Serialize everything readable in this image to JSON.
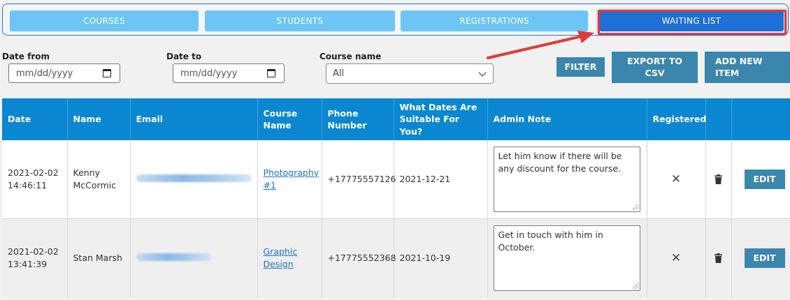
{
  "tabs": [
    {
      "label": "COURSES",
      "active": false
    },
    {
      "label": "STUDENTS",
      "active": false
    },
    {
      "label": "REGISTRATIONS",
      "active": false
    },
    {
      "label": "WAITING LIST",
      "active": true
    }
  ],
  "filters": {
    "date_from_label": "Date from",
    "date_from_placeholder": "mm/dd/yyyy",
    "date_to_label": "Date to",
    "date_to_placeholder": "mm/dd/yyyy",
    "course_label": "Course name",
    "course_value": "All"
  },
  "actions": {
    "filter": "FILTER",
    "export_line1": "EXPORT TO",
    "export_line2": "CSV",
    "add_line1": "ADD NEW",
    "add_line2": "ITEM"
  },
  "table": {
    "headers": {
      "date": "Date",
      "name": "Name",
      "email": "Email",
      "course_l1": "Course",
      "course_l2": "Name",
      "phone_l1": "Phone",
      "phone_l2": "Number",
      "dates_l1": "What Dates Are",
      "dates_l2": "Suitable For You?",
      "note": "Admin Note",
      "registered": "Registered"
    },
    "rows": [
      {
        "date": "2021-02-02",
        "time": "14:46:11",
        "name_l1": "Kenny",
        "name_l2": "McCormic",
        "course_l1": "Photography",
        "course_l2": "#1",
        "phone": "+17775557126",
        "suitable": "2021-12-21",
        "note": "Let him know if there will be any discount for the course.",
        "registered": "✕",
        "edit": "EDIT"
      },
      {
        "date": "2021-02-02",
        "time": "13:41:39",
        "name": "Stan Marsh",
        "course_l1": "Graphic",
        "course_l2": "Design",
        "phone": "+17775552368",
        "suitable": "2021-10-19",
        "note": "Get in touch with him in October.",
        "registered": "✕",
        "edit": "EDIT"
      }
    ]
  },
  "colors": {
    "tab": "#6cc5f5",
    "tab_active": "#1e6fd6",
    "header": "#0b87d1",
    "button": "#3b86ad",
    "annotation": "#e03a3a"
  },
  "icons": [
    "calendar-icon",
    "chevron-down-icon",
    "close-icon",
    "trash-icon"
  ]
}
